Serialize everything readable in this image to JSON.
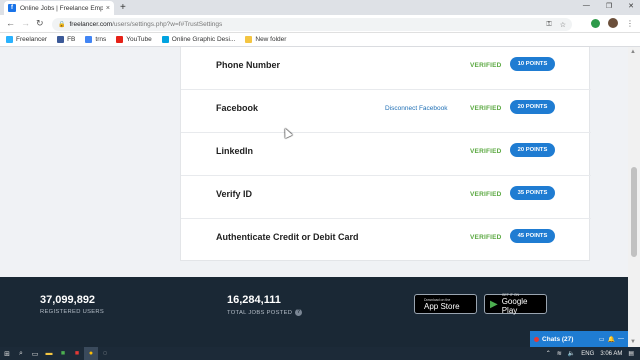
{
  "browser": {
    "tab_title": "Online Jobs | Freelance Employ...",
    "tab_close": "×",
    "new_tab": "+",
    "url_host": "freelancer.com",
    "url_path": "/users/settings.php?w=f#TrustSettings",
    "bookmarks": [
      {
        "label": "Freelancer",
        "color": "#29b2fe"
      },
      {
        "label": "FB",
        "color": "#3b5998"
      },
      {
        "label": "trns",
        "color": "#4285f4"
      },
      {
        "label": "YouTube",
        "color": "#e62117"
      },
      {
        "label": "Online Graphic Desi...",
        "color": "#00a3e0"
      },
      {
        "label": "New folder",
        "color": "#f4c542"
      }
    ]
  },
  "verifications": [
    {
      "label": "Phone Number",
      "link": "",
      "status": "VERIFIED",
      "points": "10 POINTS"
    },
    {
      "label": "Facebook",
      "link": "Disconnect Facebook",
      "status": "VERIFIED",
      "points": "20 POINTS"
    },
    {
      "label": "LinkedIn",
      "link": "",
      "status": "VERIFIED",
      "points": "20 POINTS"
    },
    {
      "label": "Verify ID",
      "link": "",
      "status": "VERIFIED",
      "points": "35 POINTS"
    },
    {
      "label": "Authenticate Credit or Debit Card",
      "link": "",
      "status": "VERIFIED",
      "points": "45 POINTS"
    }
  ],
  "footer": {
    "registered_users_count": "37,099,892",
    "registered_users_label": "REGISTERED USERS",
    "total_jobs_count": "16,284,111",
    "total_jobs_label": "TOTAL JOBS POSTED",
    "help_glyph": "?",
    "app_store_small": "Download on the",
    "app_store_big": "App Store",
    "google_play_small": "GET IT ON",
    "google_play_big": "Google Play"
  },
  "chats": {
    "label": "Chats (27)"
  },
  "taskbar": {
    "language": "ENG",
    "time": "3:06 AM"
  },
  "colors": {
    "accent": "#1f7cd2",
    "verified": "#5aa840",
    "footer_bg": "#1a2835"
  }
}
